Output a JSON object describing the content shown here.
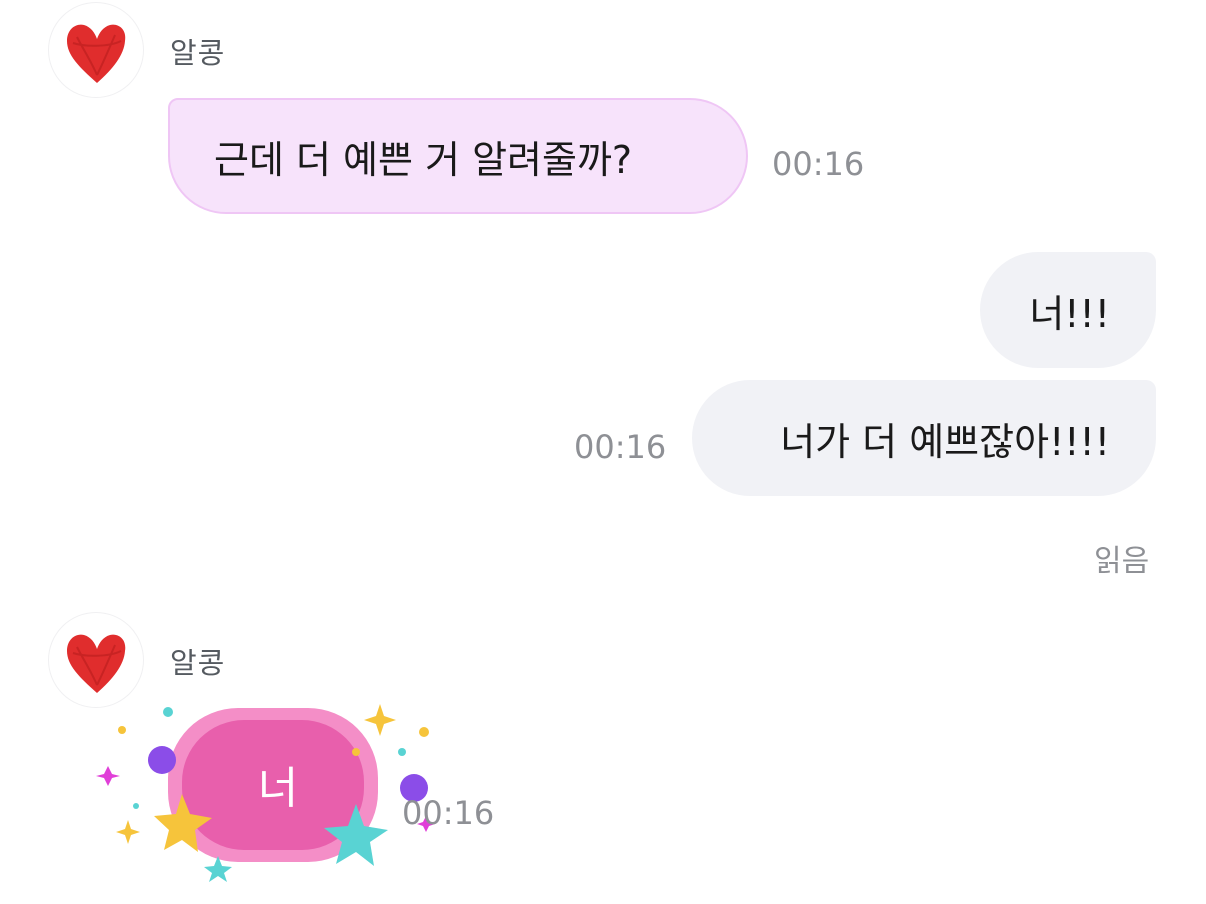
{
  "messages": [
    {
      "sender": "알콩",
      "avatar_icon": "red-heart-icon",
      "text": "근데 더 예쁜 거 알려줄까?",
      "time": "00:16"
    },
    {
      "outgoing": [
        {
          "text": "너!!!"
        },
        {
          "text": "너가 더 예쁘잖아!!!!",
          "time": "00:16"
        }
      ],
      "read_status": "읽음"
    },
    {
      "sender": "알콩",
      "avatar_icon": "red-heart-icon",
      "sticker_icon": "sparkle-sticker-icon",
      "sticker_text": "너",
      "time": "00:16"
    }
  ],
  "colors": {
    "incoming_bubble": "#f7e3fb",
    "outgoing_bubble": "#f1f2f6",
    "heart": "#e02d2d",
    "sticker_pink": "#e85fac"
  }
}
